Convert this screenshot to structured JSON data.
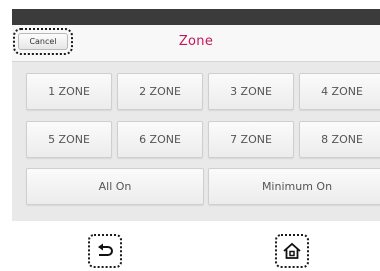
{
  "header": {
    "cancel_label": "Cancel",
    "title": "Zone"
  },
  "zones": [
    {
      "label": "1 ZONE"
    },
    {
      "label": "2 ZONE"
    },
    {
      "label": "3 ZONE"
    },
    {
      "label": "4 ZONE"
    },
    {
      "label": "5 ZONE"
    },
    {
      "label": "6 ZONE"
    },
    {
      "label": "7 ZONE"
    },
    {
      "label": "8 ZONE"
    }
  ],
  "actions": {
    "all_on": "All On",
    "minimum_on": "Minimum On"
  },
  "nav": {
    "back_icon": "back-arrow-icon",
    "home_icon": "home-icon"
  },
  "colors": {
    "title": "#c2185b",
    "top_bar": "#3b3b3b",
    "panel": "#e9e9e9"
  }
}
